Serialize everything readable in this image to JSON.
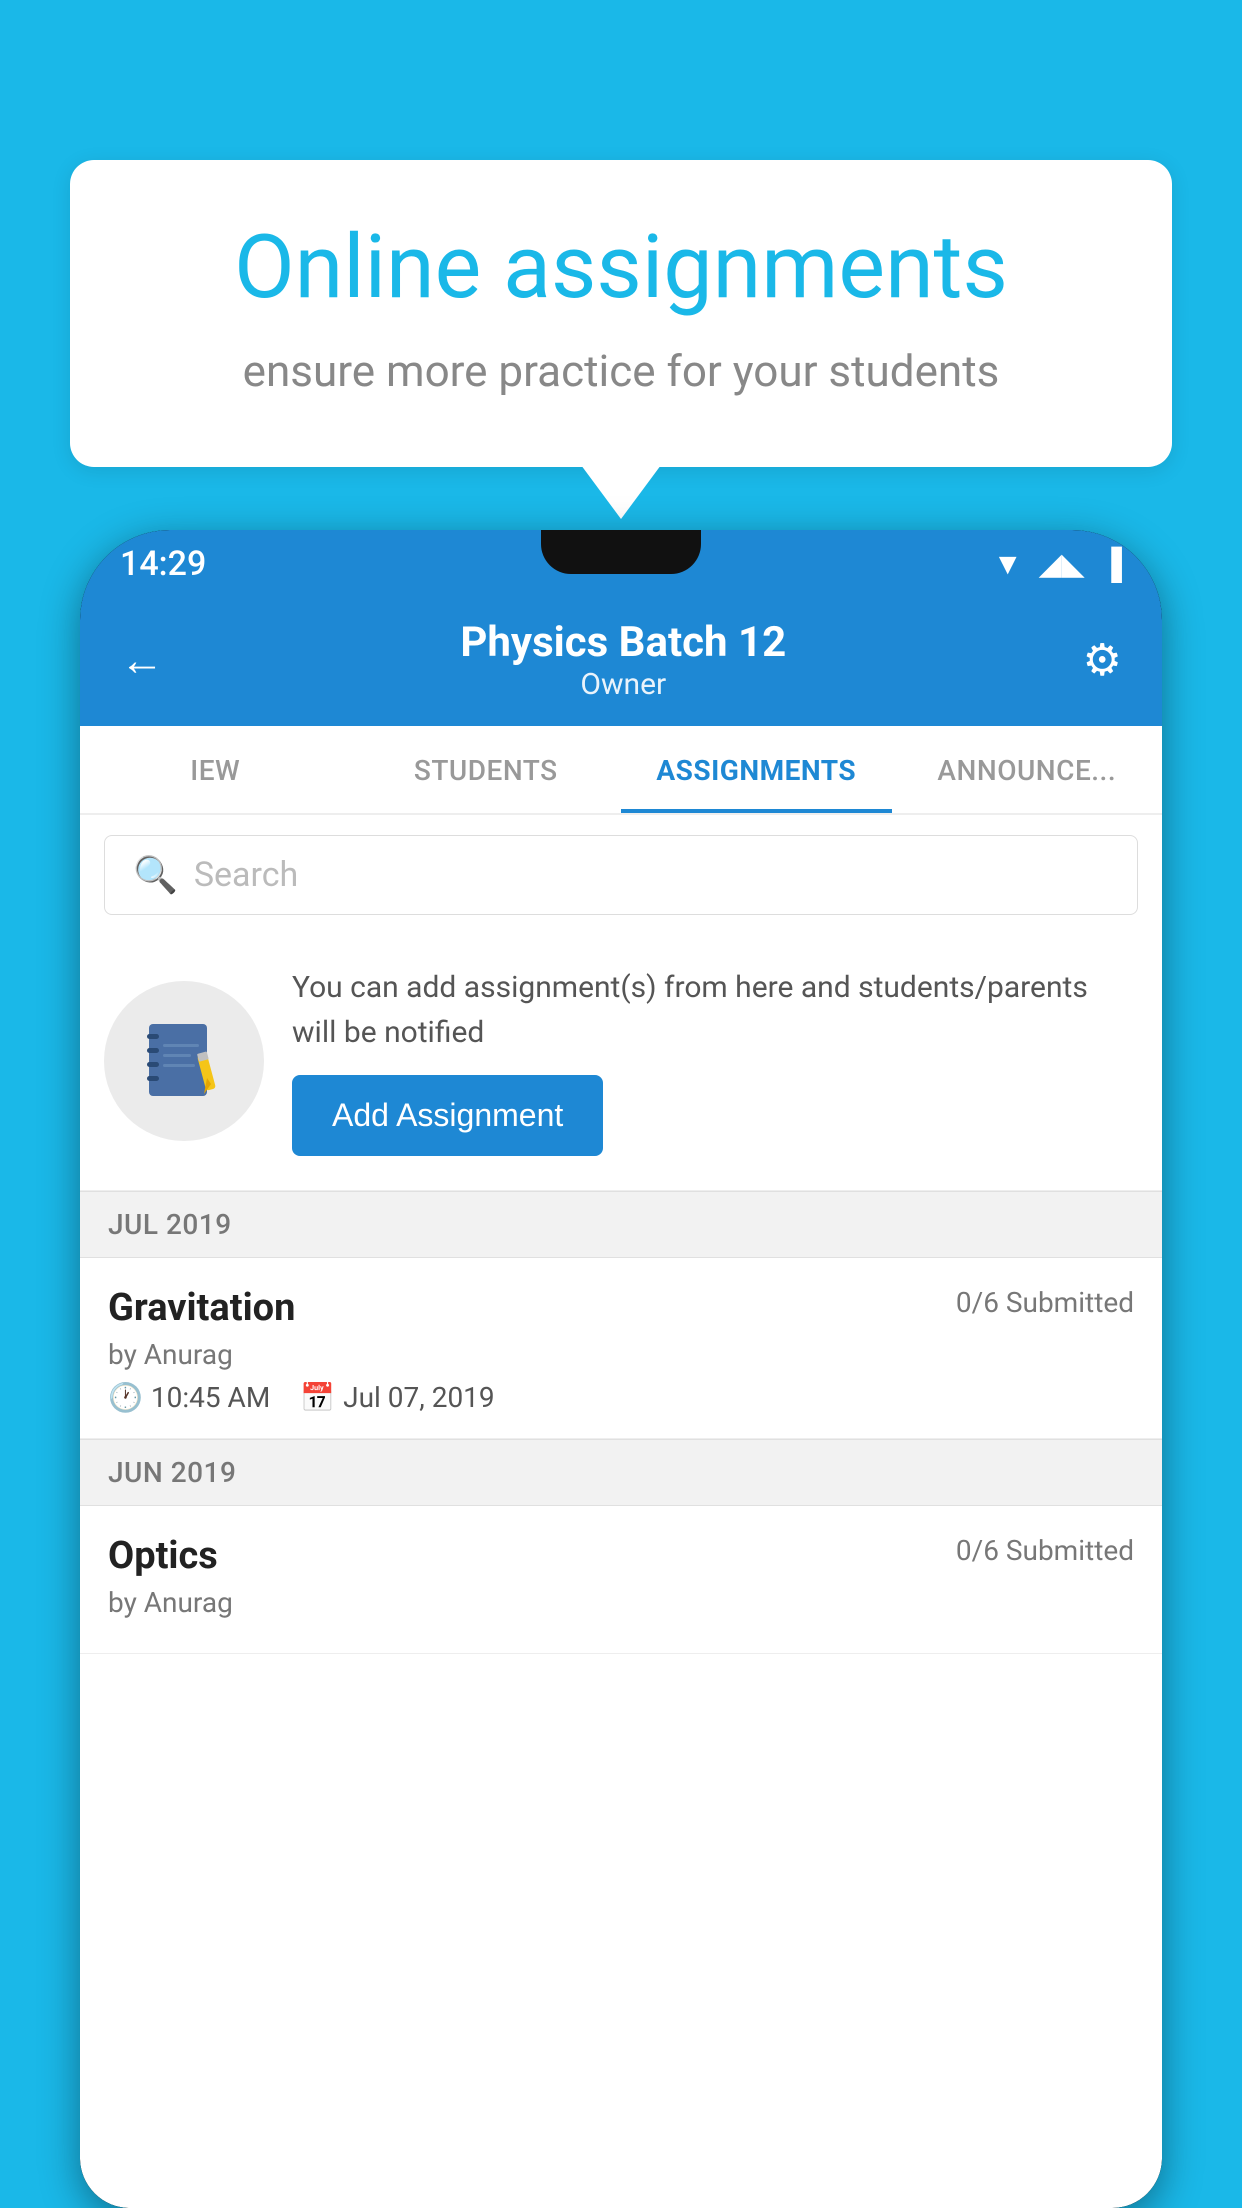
{
  "background_color": "#1ab8e8",
  "speech_bubble": {
    "title": "Online assignments",
    "subtitle": "ensure more practice for your students"
  },
  "status_bar": {
    "time": "14:29",
    "wifi": "▲",
    "signal": "▲",
    "battery": "▐"
  },
  "header": {
    "title": "Physics Batch 12",
    "subtitle": "Owner"
  },
  "tabs": [
    {
      "label": "IEW",
      "active": false
    },
    {
      "label": "STUDENTS",
      "active": false
    },
    {
      "label": "ASSIGNMENTS",
      "active": true
    },
    {
      "label": "ANNOUNCE...",
      "active": false
    }
  ],
  "search": {
    "placeholder": "Search"
  },
  "add_section": {
    "description": "You can add assignment(s) from here and students/parents will be notified",
    "button_label": "Add Assignment"
  },
  "month_groups": [
    {
      "month": "JUL 2019",
      "assignments": [
        {
          "title": "Gravitation",
          "submitted": "0/6 Submitted",
          "by": "by Anurag",
          "time": "10:45 AM",
          "date": "Jul 07, 2019"
        }
      ]
    },
    {
      "month": "JUN 2019",
      "assignments": [
        {
          "title": "Optics",
          "submitted": "0/6 Submitted",
          "by": "by Anurag",
          "time": "",
          "date": ""
        }
      ]
    }
  ]
}
